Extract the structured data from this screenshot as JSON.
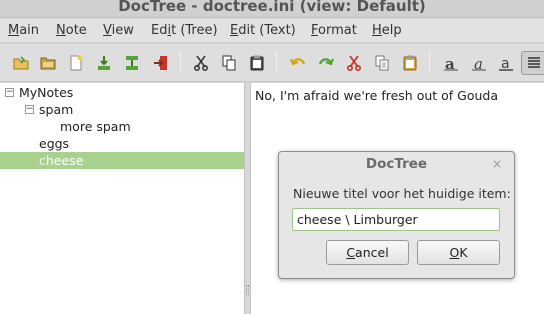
{
  "window": {
    "title": "DocTree - doctree.ini (view: Default)"
  },
  "menubar": [
    {
      "label": "Main",
      "mnemonic": "M",
      "rest": "ain"
    },
    {
      "label": "Note",
      "mnemonic": "N",
      "rest": "ote"
    },
    {
      "label": "View",
      "mnemonic": "V",
      "rest": "iew"
    },
    {
      "label": "Edit (Tree)",
      "pre": "Ed",
      "mnemonic": "i",
      "rest": "t (Tree)"
    },
    {
      "label": "Edit (Text)",
      "mnemonic": "E",
      "rest": "dit (Text)"
    },
    {
      "label": "Format",
      "mnemonic": "F",
      "rest": "ormat"
    },
    {
      "label": "Help",
      "mnemonic": "H",
      "rest": "elp"
    }
  ],
  "toolbar": {
    "icons": [
      "open-folder-icon",
      "folder-icon",
      "new-note-icon",
      "add-child-icon",
      "add-sibling-icon",
      "exit-icon",
      "cut-icon",
      "copy-icon",
      "paste-icon",
      "undo-icon",
      "redo-icon",
      "cut-text-icon",
      "copy-text-icon",
      "paste-text-icon",
      "bold-icon",
      "italic-icon",
      "align-icon"
    ]
  },
  "tree": {
    "root": "MyNotes",
    "child1": "spam",
    "grandchild": "more spam",
    "child2": "eggs",
    "child3": "cheese",
    "selected": "cheese",
    "collapse_glyph": "−"
  },
  "editor": {
    "text": "No, I'm afraid we're fresh out of Gouda"
  },
  "dialog": {
    "title": "DocTree",
    "close_glyph": "×",
    "prompt": "Nieuwe titel voor het huidige item:",
    "value": "cheese \\ Limburger",
    "cancel": {
      "label": "Cancel",
      "mnemonic": "C",
      "rest": "ancel"
    },
    "ok": {
      "label": "OK",
      "mnemonic": "O",
      "rest": "K"
    }
  },
  "colors": {
    "selection": "#a9d18e",
    "input_border": "#a0c48a"
  }
}
